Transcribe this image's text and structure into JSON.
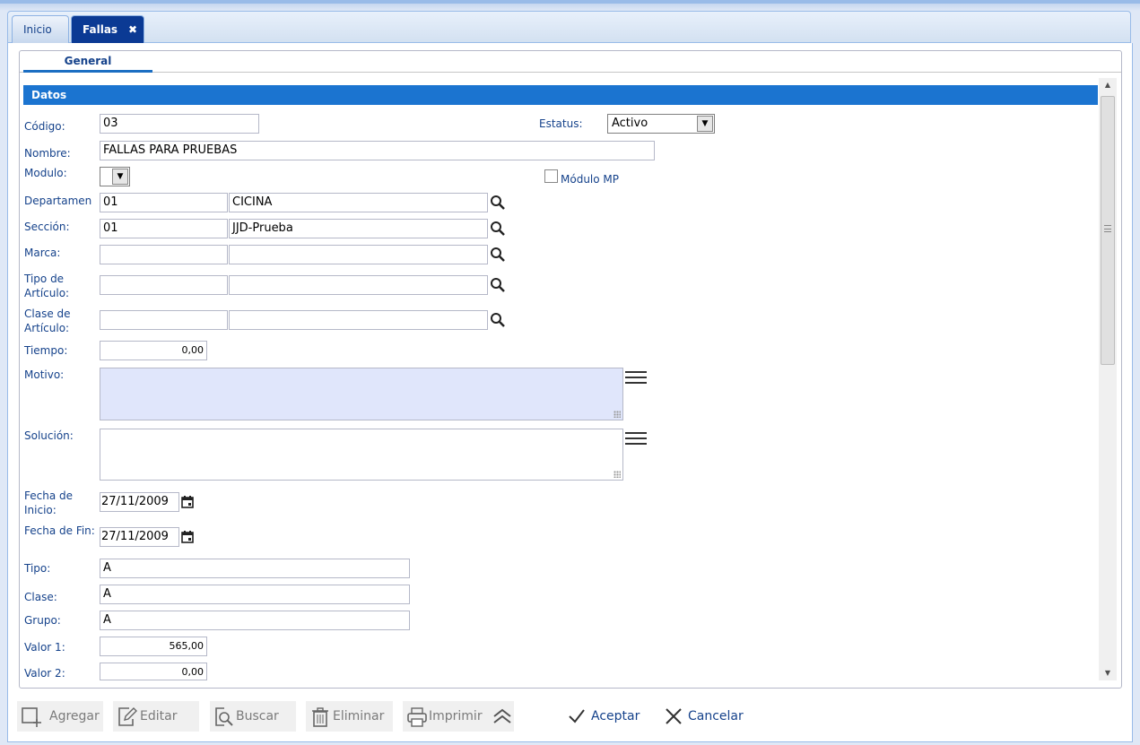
{
  "tabs": [
    {
      "label": "Inicio"
    },
    {
      "label": "Fallas"
    }
  ],
  "subtab": {
    "label": "General"
  },
  "section": {
    "title": "Datos"
  },
  "form": {
    "codigo": {
      "label": "Código:",
      "value": "03"
    },
    "estatus": {
      "label": "Estatus:",
      "value": "Activo"
    },
    "nombre": {
      "label": "Nombre:",
      "value": "FALLAS PARA PRUEBAS"
    },
    "modulo": {
      "label": "Modulo:",
      "value": ""
    },
    "modulo_mp": {
      "label": "Módulo MP",
      "checked": false
    },
    "departamento": {
      "label": "Departamen",
      "code": "01",
      "name": "CICINA"
    },
    "seccion": {
      "label": "Sección:",
      "code": "01",
      "name": "JJD-Prueba"
    },
    "marca": {
      "label": "Marca:",
      "code": "",
      "name": ""
    },
    "tipo_articulo": {
      "label": "Tipo de Artículo:",
      "code": "",
      "name": ""
    },
    "clase_articulo": {
      "label": "Clase de Artículo:",
      "code": "",
      "name": ""
    },
    "tiempo": {
      "label": "Tiempo:",
      "value": "0,00"
    },
    "motivo": {
      "label": "Motivo:",
      "value": ""
    },
    "solucion": {
      "label": "Solución:",
      "value": ""
    },
    "fecha_inicio": {
      "label": "Fecha de Inicio:",
      "value": "27/11/2009"
    },
    "fecha_fin": {
      "label": "Fecha de Fin:",
      "value": "27/11/2009"
    },
    "tipo": {
      "label": "Tipo:",
      "value": "A"
    },
    "clase": {
      "label": "Clase:",
      "value": "A"
    },
    "grupo": {
      "label": "Grupo:",
      "value": "A"
    },
    "valor1": {
      "label": "Valor 1:",
      "value": "565,00"
    },
    "valor2": {
      "label": "Valor 2:",
      "value": "0,00"
    }
  },
  "toolbar": {
    "agregar": "Agregar",
    "editar": "Editar",
    "buscar": "Buscar",
    "eliminar": "Eliminar",
    "imprimir": "Imprimir",
    "aceptar": "Aceptar",
    "cancelar": "Cancelar"
  },
  "colors": {
    "header_blue": "#1b74d0",
    "active_tab": "#0b3a94",
    "label_text": "#15428b",
    "motivo_bg": "#e0e6fb"
  }
}
